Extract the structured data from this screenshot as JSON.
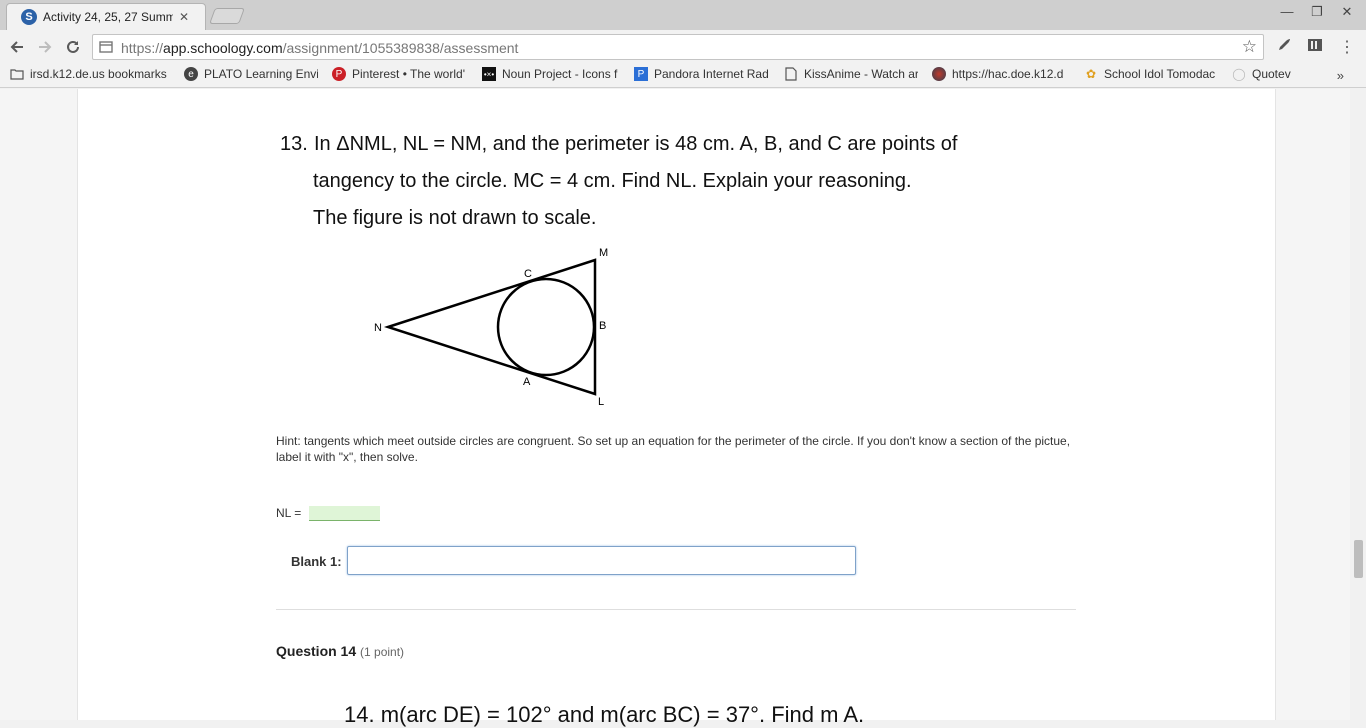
{
  "browser": {
    "tab_title": "Activity 24, 25, 27 Summ",
    "tab_favicon_letter": "S",
    "url_scheme": "https://",
    "url_domain": "app.schoology.com",
    "url_path": "/assignment/1055389838/assessment"
  },
  "bookmarks": [
    {
      "label": "irsd.k12.de.us bookmarks",
      "icon": "folder-icon"
    },
    {
      "label": "PLATO Learning Envi",
      "icon": "plato-icon"
    },
    {
      "label": "Pinterest • The world'",
      "icon": "pinterest-icon"
    },
    {
      "label": "Noun Project - Icons f",
      "icon": "noun-project-icon"
    },
    {
      "label": "Pandora Internet Rad",
      "icon": "pandora-icon"
    },
    {
      "label": "KissAnime - Watch ar",
      "icon": "page-icon"
    },
    {
      "label": "https://hac.doe.k12.d",
      "icon": "globe-icon"
    },
    {
      "label": "School Idol Tomodac",
      "icon": "school-idol-icon"
    },
    {
      "label": "Quotev",
      "icon": "quotev-icon"
    }
  ],
  "question13": {
    "number": "13.",
    "line1": "In  ΔNML, NL = NM, and the perimeter is 48 cm.  A, B, and C are points of",
    "line2": "tangency to the circle.  MC = 4 cm.  Find NL. Explain your reasoning.",
    "line3": "The figure is not drawn to scale.",
    "figure_labels": {
      "M": "M",
      "C": "C",
      "N": "N",
      "B": "B",
      "A": "A",
      "L": "L"
    },
    "hint": "Hint: tangents which meet outside circles are congruent.  So set up an equation for the perimeter of the circle.  If you don't know a section of the pictue, label it with \"x\", then solve.",
    "nl_label": "NL =",
    "blank_label": "Blank 1:",
    "blank_value": ""
  },
  "question14": {
    "title": "Question 14",
    "points": "(1 point)",
    "text": "14.  m(arc DE) = 102° and m(arc BC) = 37°.  Find m  A."
  }
}
